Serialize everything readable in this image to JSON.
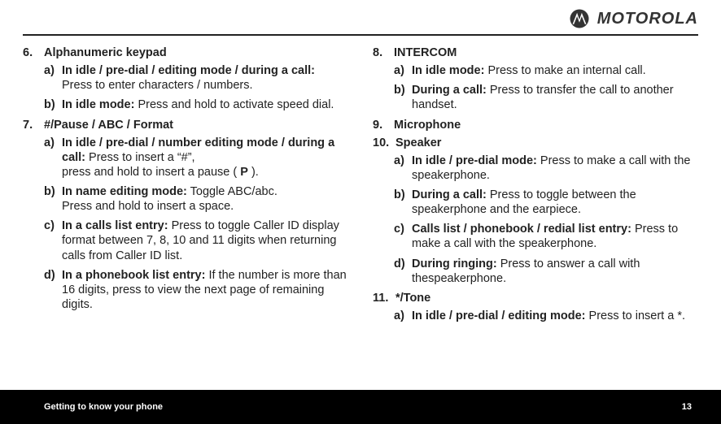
{
  "brand": {
    "wordmark": "MOTOROLA"
  },
  "footer": {
    "section": "Getting to know your phone",
    "page": "13"
  },
  "left": {
    "item6": {
      "num": "6.",
      "title": "Alphanumeric keypad",
      "a": {
        "l": "a)",
        "lead": "In idle / pre-dial / editing mode / during a call:",
        "rest": " Press to enter characters / numbers."
      },
      "b": {
        "l": "b)",
        "lead": "In idle mode:",
        "rest": " Press and hold to activate speed dial."
      }
    },
    "item7": {
      "num": "7.",
      "title": "#/Pause / ABC / Format",
      "a": {
        "l": "a)",
        "lead": "In idle / pre-dial / number editing mode / during a call:",
        "rest1": " Press to insert a “#”,",
        "rest2": "press and hold to insert a pause ( ",
        "bold": "P",
        "rest3": " )."
      },
      "b": {
        "l": "b)",
        "lead": "In name editing mode:",
        "rest1": " Toggle ABC/abc.",
        "rest2": "Press and hold to insert a space."
      },
      "c": {
        "l": "c)",
        "lead": "In a calls list entry:",
        "rest": " Press to toggle Caller ID display format between 7, 8, 10 and 11 digits when returning calls from Caller ID list."
      },
      "d": {
        "l": "d)",
        "lead": "In a phonebook list entry:",
        "rest": " If the number is more than 16 digits, press to view the next page of remaining digits."
      }
    }
  },
  "right": {
    "item8": {
      "num": "8.",
      "title": "INTERCOM",
      "a": {
        "l": "a)",
        "lead": "In idle mode:",
        "rest": " Press to make an internal call."
      },
      "b": {
        "l": "b)",
        "lead": "During a call:",
        "rest": " Press to transfer the call to another handset."
      }
    },
    "item9": {
      "num": "9.",
      "title": "Microphone"
    },
    "item10": {
      "num": "10.",
      "title": "Speaker",
      "a": {
        "l": "a)",
        "lead": "In idle / pre-dial mode:",
        "rest": " Press to make a call with the speakerphone."
      },
      "b": {
        "l": "b)",
        "lead": "During a call:",
        "rest": " Press to toggle between the speakerphone and the earpiece."
      },
      "c": {
        "l": "c)",
        "lead": "Calls list / phonebook / redial list entry:",
        "rest": " Press to make a call with the speakerphone."
      },
      "d": {
        "l": "d)",
        "lead": "During ringing:",
        "rest": " Press to answer a call with thespeakerphone."
      }
    },
    "item11": {
      "num": "11.",
      "title": " */Tone",
      "a": {
        "l": "a)",
        "lead": "In idle / pre-dial / editing mode:",
        "rest": " Press to insert a *."
      }
    }
  }
}
